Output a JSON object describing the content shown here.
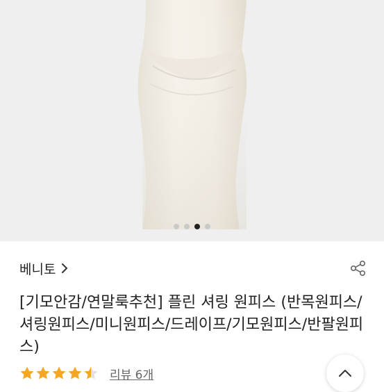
{
  "product": {
    "brand": "베니토",
    "title": "[기모안감/연말룩추천] 플린 셔링 원피스 (반목원피스/셔링원피스/미니원피스/드레이프/기모원피스/반팔원피스)",
    "rating": 4.5,
    "rating_max": 5,
    "review_link": "리뷰 6개"
  },
  "gallery": {
    "slide_count": 4,
    "active_index": 2
  },
  "colors": {
    "star": "#f5a623",
    "active_dot": "#222222",
    "inactive_dot": "#c9c9c9"
  },
  "icons": {
    "brand_chevron": "chevron-right-icon",
    "share": "share-icon",
    "scroll_top": "chevron-up-icon",
    "star": "star-icon"
  }
}
